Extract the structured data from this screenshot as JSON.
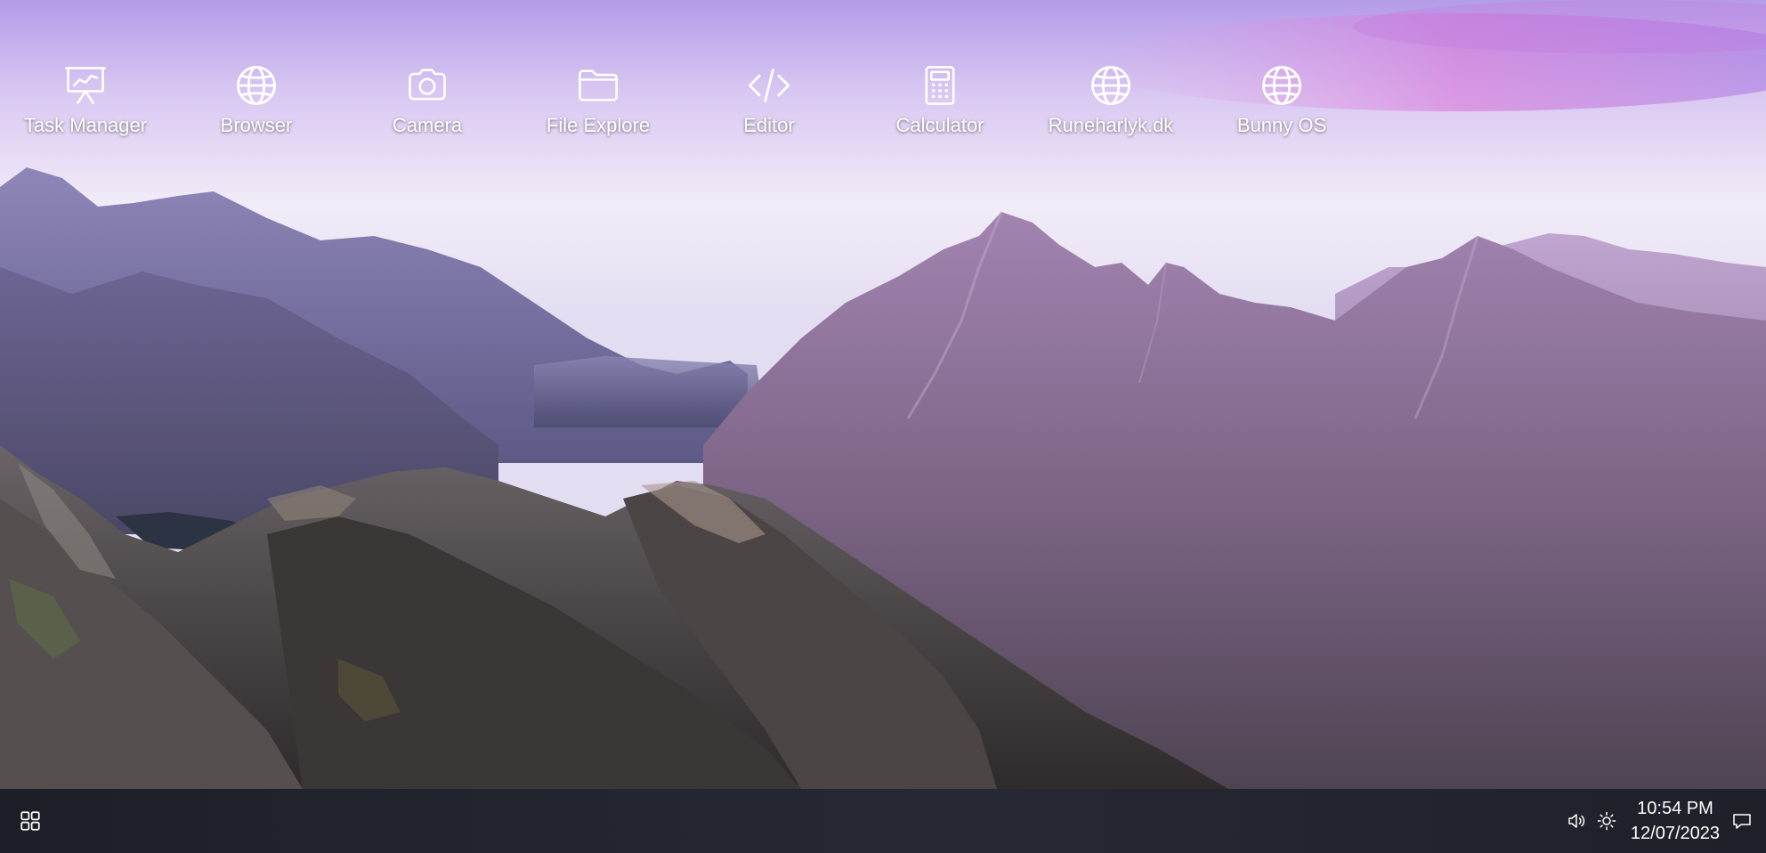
{
  "desktop": {
    "icons": [
      {
        "label": "Task Manager",
        "icon": "task-manager-icon"
      },
      {
        "label": "Browser",
        "icon": "globe-icon"
      },
      {
        "label": "Camera",
        "icon": "camera-icon"
      },
      {
        "label": "File Explore",
        "icon": "folder-icon"
      },
      {
        "label": "Editor",
        "icon": "code-icon"
      },
      {
        "label": "Calculator",
        "icon": "calculator-icon"
      },
      {
        "label": "Runeharlyk.dk",
        "icon": "globe-icon"
      },
      {
        "label": "Bunny OS",
        "icon": "globe-icon"
      }
    ]
  },
  "taskbar": {
    "start_icon": "grid-icon",
    "tray": {
      "volume_icon": "volume-icon",
      "brightness_icon": "brightness-icon",
      "notification_icon": "chat-icon"
    },
    "clock": {
      "time": "10:54 PM",
      "date": "12/07/2023"
    }
  },
  "colors": {
    "taskbar_background": "#23252f",
    "icon_foreground": "#ffffff"
  }
}
